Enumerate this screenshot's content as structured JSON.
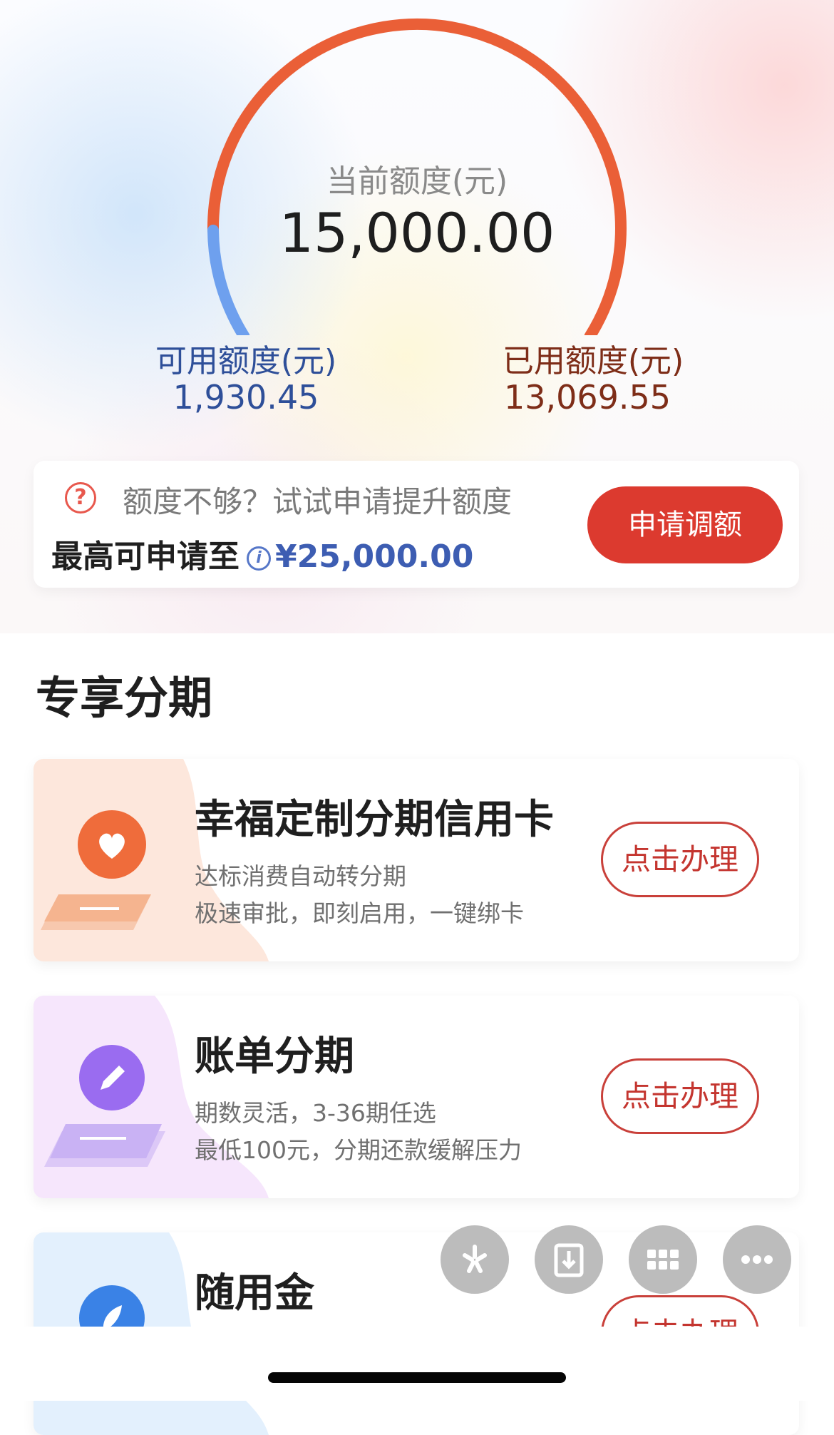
{
  "credit": {
    "current_label": "当前额度(元)",
    "current_value": "15,000.00",
    "available_label": "可用额度(元)",
    "available_value": "1,930.45",
    "used_label": "已用额度(元)",
    "used_value": "13,069.55",
    "used_fraction": 0.8713,
    "colors": {
      "available": "#6ea0ee",
      "used": "#ea5f37"
    }
  },
  "apply": {
    "prompt": "额度不够？试试申请提升额度",
    "max_label": "最高可申请至",
    "max_value": "¥25,000.00",
    "button_label": "申请调额",
    "icons": [
      "question-icon",
      "info-icon"
    ]
  },
  "section": {
    "title": "专享分期"
  },
  "products": [
    {
      "title": "幸福定制分期信用卡",
      "desc1": "达标消费自动转分期",
      "desc2": "极速审批，即刻启用，一键绑卡",
      "button_label": "点击办理",
      "icon": "heart-icon",
      "color": "#ef6c3b"
    },
    {
      "title": "账单分期",
      "desc1": "期数灵活，3-36期任选",
      "desc2": "最低100元，分期还款缓解压力",
      "button_label": "点击办理",
      "icon": "pencil-icon",
      "color": "#9a6cf0"
    },
    {
      "title": "随用金",
      "button_label": "点击办理",
      "icon": "rocket-icon",
      "color": "#3a82e6"
    }
  ],
  "floating_actions": [
    "sparkle-icon",
    "download-icon",
    "grid-icon",
    "more-icon"
  ]
}
